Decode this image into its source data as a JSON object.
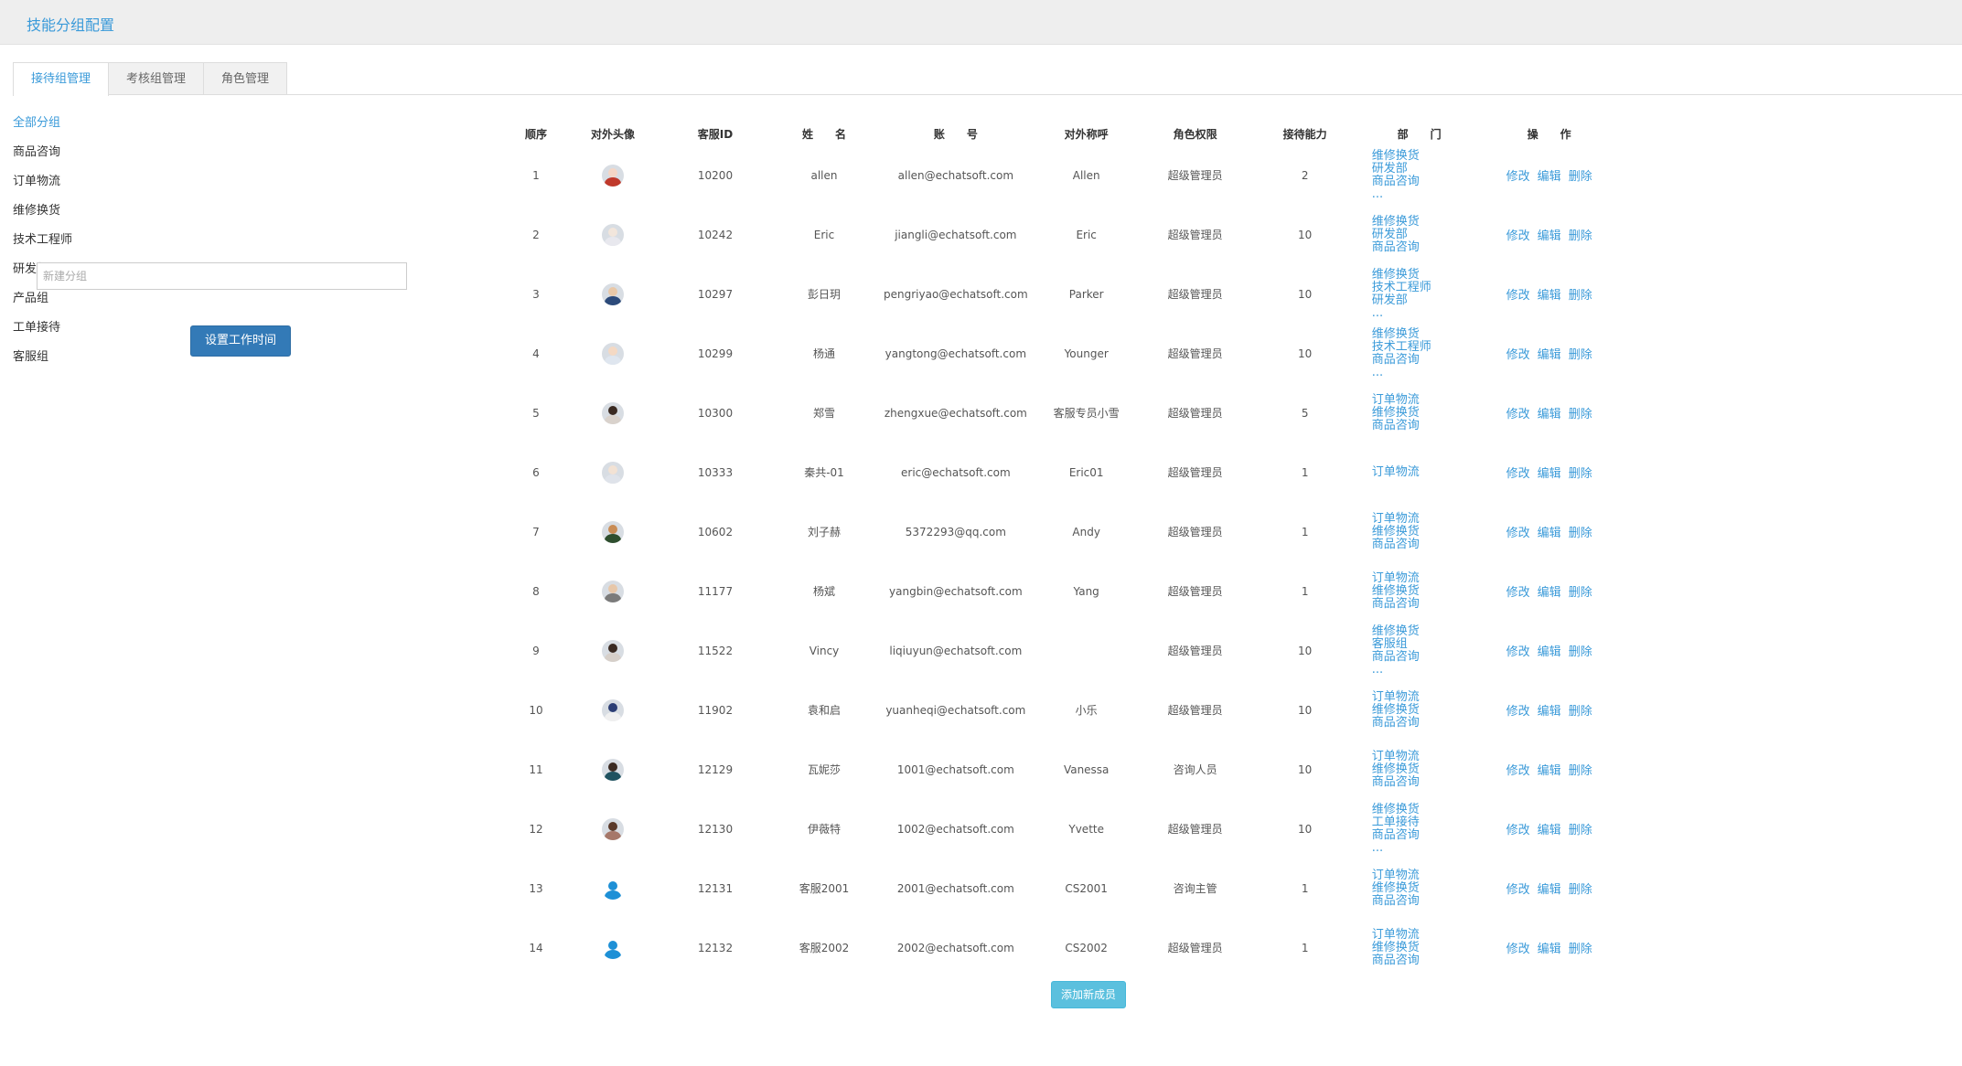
{
  "header": {
    "title": "技能分组配置"
  },
  "tabs": [
    {
      "label": "接待组管理",
      "active": true
    },
    {
      "label": "考核组管理",
      "active": false
    },
    {
      "label": "角色管理",
      "active": false
    }
  ],
  "sidebar": {
    "groups": [
      "全部分组",
      "商品咨询",
      "订单物流",
      "维修换货",
      "技术工程师",
      "研发部",
      "产品组",
      "工单接待",
      "客服组"
    ],
    "active_index": 0,
    "new_group_placeholder": "新建分组",
    "set_worktime_label": "设置工作时间"
  },
  "table": {
    "columns": [
      "顺序",
      "对外头像",
      "客服ID",
      "姓　　名",
      "账　　号",
      "对外称呼",
      "角色权限",
      "接待能力",
      "部　　门",
      "操　　作"
    ],
    "actions": {
      "modify": "修改",
      "edit": "编辑",
      "delete": "删除"
    },
    "rows": [
      {
        "order": "1",
        "avatar": "photo-avatar-icon",
        "id": "10200",
        "name": "allen",
        "account": "allen@echatsoft.com",
        "nickname": "Allen",
        "role": "超级管理员",
        "capacity": "2",
        "depts": [
          "维修换货",
          "研发部",
          "商品咨询",
          "..."
        ]
      },
      {
        "order": "2",
        "avatar": "photo-avatar-icon",
        "id": "10242",
        "name": "Eric",
        "account": "jiangli@echatsoft.com",
        "nickname": "Eric",
        "role": "超级管理员",
        "capacity": "10",
        "depts": [
          "维修换货",
          "研发部",
          "商品咨询"
        ]
      },
      {
        "order": "3",
        "avatar": "photo-avatar-icon",
        "id": "10297",
        "name": "彭日玥",
        "account": "pengriyao@echatsoft.com",
        "nickname": "Parker",
        "role": "超级管理员",
        "capacity": "10",
        "depts": [
          "维修换货",
          "技术工程师",
          "研发部",
          "..."
        ]
      },
      {
        "order": "4",
        "avatar": "photo-avatar-icon",
        "id": "10299",
        "name": "杨通",
        "account": "yangtong@echatsoft.com",
        "nickname": "Younger",
        "role": "超级管理员",
        "capacity": "10",
        "depts": [
          "维修换货",
          "技术工程师",
          "商品咨询",
          "..."
        ]
      },
      {
        "order": "5",
        "avatar": "photo-avatar-icon",
        "id": "10300",
        "name": "郑雪",
        "account": "zhengxue@echatsoft.com",
        "nickname": "客服专员小雪",
        "role": "超级管理员",
        "capacity": "5",
        "depts": [
          "订单物流",
          "维修换货",
          "商品咨询"
        ]
      },
      {
        "order": "6",
        "avatar": "photo-avatar-icon",
        "id": "10333",
        "name": "秦共-01",
        "account": "eric@echatsoft.com",
        "nickname": "Eric01",
        "role": "超级管理员",
        "capacity": "1",
        "depts": [
          "订单物流"
        ]
      },
      {
        "order": "7",
        "avatar": "photo-avatar-icon",
        "id": "10602",
        "name": "刘子赫",
        "account": "5372293@qq.com",
        "nickname": "Andy",
        "role": "超级管理员",
        "capacity": "1",
        "depts": [
          "订单物流",
          "维修换货",
          "商品咨询"
        ]
      },
      {
        "order": "8",
        "avatar": "photo-avatar-icon",
        "id": "11177",
        "name": "杨斌",
        "account": "yangbin@echatsoft.com",
        "nickname": "Yang",
        "role": "超级管理员",
        "capacity": "1",
        "depts": [
          "订单物流",
          "维修换货",
          "商品咨询"
        ]
      },
      {
        "order": "9",
        "avatar": "photo-avatar-icon",
        "id": "11522",
        "name": "Vincy",
        "account": "liqiuyun@echatsoft.com",
        "nickname": "",
        "role": "超级管理员",
        "capacity": "10",
        "depts": [
          "维修换货",
          "客服组",
          "商品咨询",
          "..."
        ]
      },
      {
        "order": "10",
        "avatar": "photo-avatar-icon",
        "id": "11902",
        "name": "袁和启",
        "account": "yuanheqi@echatsoft.com",
        "nickname": "小乐",
        "role": "超级管理员",
        "capacity": "10",
        "depts": [
          "订单物流",
          "维修换货",
          "商品咨询"
        ]
      },
      {
        "order": "11",
        "avatar": "photo-avatar-icon",
        "id": "12129",
        "name": "瓦妮莎",
        "account": "1001@echatsoft.com",
        "nickname": "Vanessa",
        "role": "咨询人员",
        "capacity": "10",
        "depts": [
          "订单物流",
          "维修换货",
          "商品咨询"
        ]
      },
      {
        "order": "12",
        "avatar": "photo-avatar-icon",
        "id": "12130",
        "name": "伊薇特",
        "account": "1002@echatsoft.com",
        "nickname": "Yvette",
        "role": "超级管理员",
        "capacity": "10",
        "depts": [
          "维修换货",
          "工单接待",
          "商品咨询",
          "..."
        ]
      },
      {
        "order": "13",
        "avatar": "default-user-icon",
        "id": "12131",
        "name": "客服2001",
        "account": "2001@echatsoft.com",
        "nickname": "CS2001",
        "role": "咨询主管",
        "capacity": "1",
        "depts": [
          "订单物流",
          "维修换货",
          "商品咨询"
        ]
      },
      {
        "order": "14",
        "avatar": "default-user-icon",
        "id": "12132",
        "name": "客服2002",
        "account": "2002@echatsoft.com",
        "nickname": "CS2002",
        "role": "超级管理员",
        "capacity": "1",
        "depts": [
          "订单物流",
          "维修换货",
          "商品咨询"
        ]
      }
    ]
  },
  "add_member_label": "添加新成员",
  "colors": {
    "accent": "#3a9ad9",
    "primary_button": "#337ab7",
    "info_button": "#5bc0de",
    "default_avatar": "#1e90d6"
  }
}
